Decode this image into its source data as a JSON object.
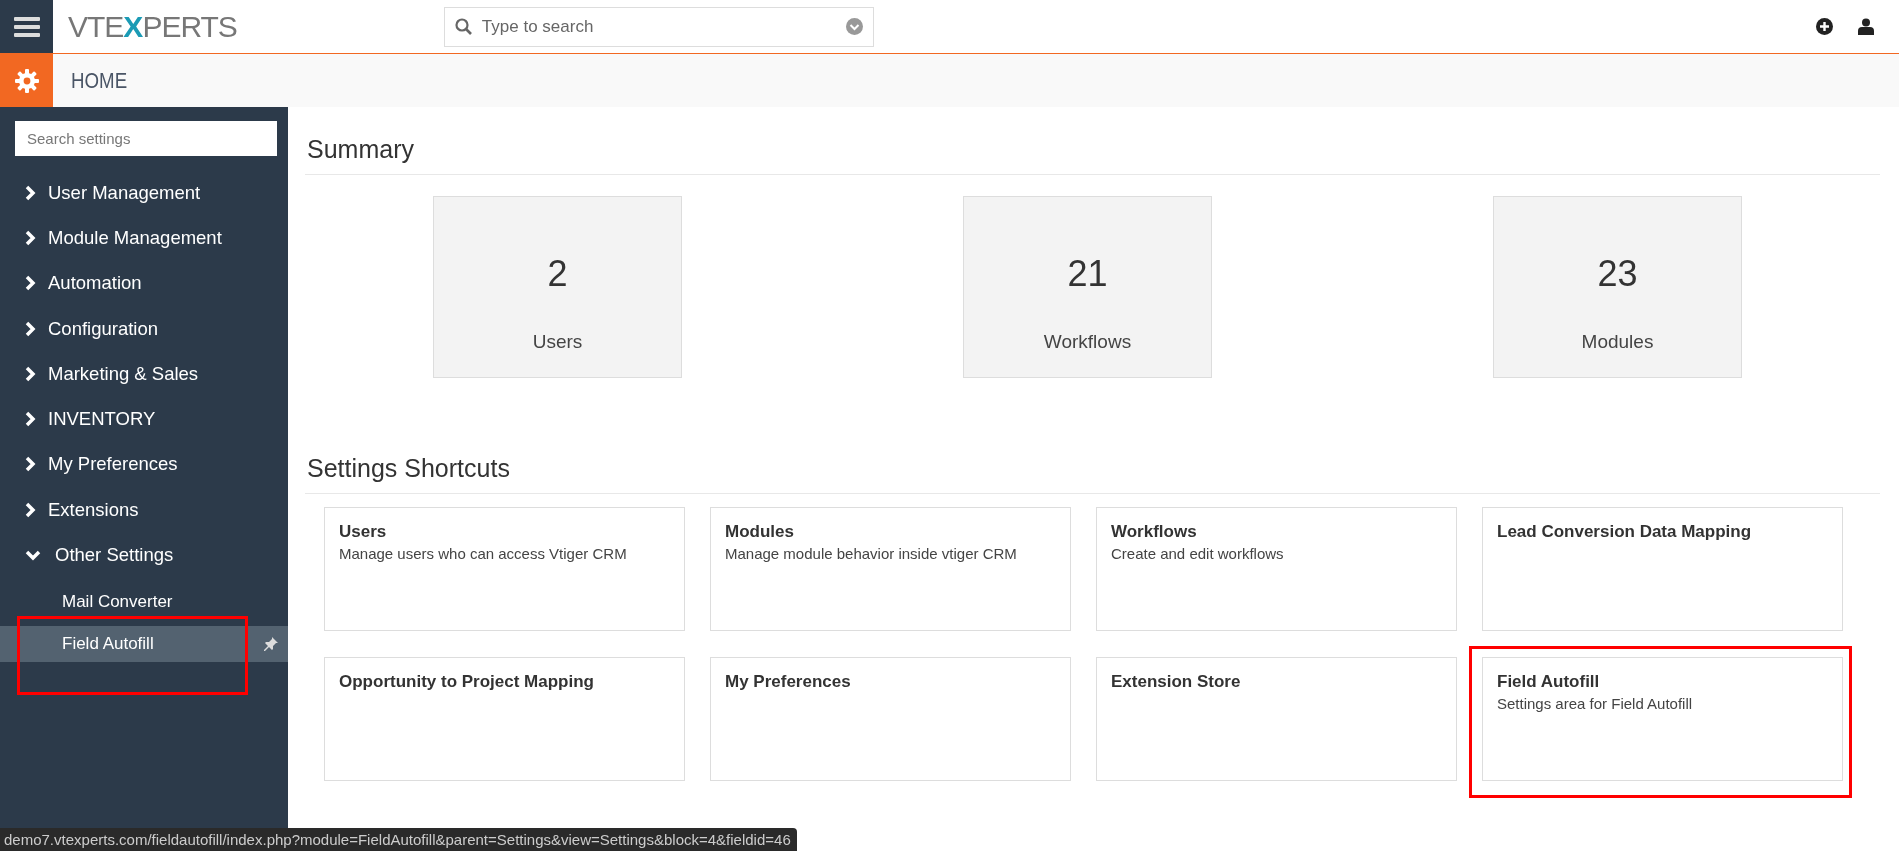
{
  "topbar": {
    "logo": "VTEXPERTS",
    "search": {
      "placeholder": "Type to search"
    }
  },
  "header": {
    "title": "HOME"
  },
  "sidebar": {
    "search": {
      "placeholder": "Search settings"
    },
    "items": [
      {
        "label": "User Management",
        "expanded": false
      },
      {
        "label": "Module Management",
        "expanded": false
      },
      {
        "label": "Automation",
        "expanded": false
      },
      {
        "label": "Configuration",
        "expanded": false
      },
      {
        "label": "Marketing & Sales",
        "expanded": false
      },
      {
        "label": "INVENTORY",
        "expanded": false
      },
      {
        "label": "My Preferences",
        "expanded": false
      },
      {
        "label": "Extensions",
        "expanded": false
      },
      {
        "label": "Other Settings",
        "expanded": true,
        "children": [
          {
            "label": "Mail Converter",
            "selected": false,
            "highlighted": false
          },
          {
            "label": "Field Autofill",
            "selected": true,
            "highlighted": true
          }
        ]
      }
    ]
  },
  "summary": {
    "title": "Summary",
    "cards": [
      {
        "value": "2",
        "label": "Users"
      },
      {
        "value": "21",
        "label": "Workflows"
      },
      {
        "value": "23",
        "label": "Modules"
      }
    ]
  },
  "shortcuts": {
    "title": "Settings Shortcuts",
    "cards": [
      {
        "title": "Users",
        "description": "Manage users who can access Vtiger CRM",
        "highlighted": false
      },
      {
        "title": "Modules",
        "description": "Manage module behavior inside vtiger CRM",
        "highlighted": false
      },
      {
        "title": "Workflows",
        "description": "Create and edit workflows",
        "highlighted": false
      },
      {
        "title": "Lead Conversion Data Mapping",
        "highlighted": false
      },
      {
        "title": "Opportunity to Project Mapping",
        "highlighted": false
      },
      {
        "title": "My Preferences",
        "highlighted": false
      },
      {
        "title": "Extension Store",
        "highlighted": false
      },
      {
        "title": "Field Autofill",
        "description": "Settings area for Field Autofill",
        "highlighted": true
      }
    ]
  },
  "status_bar": {
    "url": "demo7.vtexperts.com/fieldautofill/index.php?module=FieldAutofill&parent=Settings&view=Settings&block=4&fieldid=46"
  }
}
